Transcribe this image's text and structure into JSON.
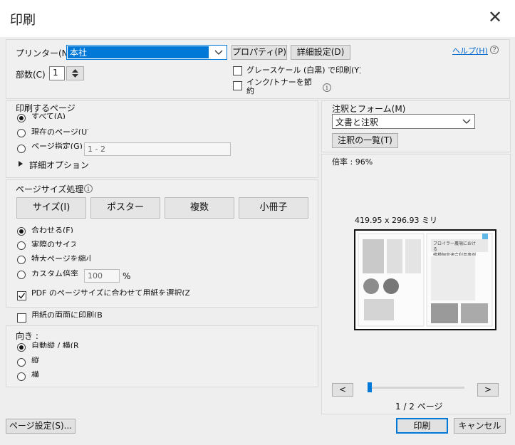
{
  "title": "印刷",
  "printer": {
    "label": "プリンター(N) :",
    "value": "本社",
    "properties_btn": "プロパティ(P)",
    "advanced_btn": "詳細設定(D)",
    "help_link": "ヘルプ(H)"
  },
  "copies": {
    "label": "部数(C) :",
    "value": "1"
  },
  "options": {
    "grayscale": "グレースケール (白黒) で印刷(Y)",
    "ink_save": "インク/トナーを節約"
  },
  "pages": {
    "header": "印刷するページ",
    "all": "すべて(A)",
    "current": "現在のページ(U)",
    "range": "ページ指定(G)",
    "range_placeholder": "1 - 2",
    "more": "詳細オプション"
  },
  "sizing": {
    "header": "ページサイズ処理",
    "buttons": [
      "サイズ(I)",
      "ポスター",
      "複数",
      "小冊子"
    ],
    "fit": "合わせる(F)",
    "actual": "実際のサイズ",
    "shrink": "特大ページを縮小",
    "custom": "カスタム倍率",
    "custom_value": "100",
    "percent": "%",
    "choose_paper": "PDF のページサイズに合わせて用紙を選択(Z)",
    "duplex": "用紙の両面に印刷(B)"
  },
  "orientation": {
    "header": "向き :",
    "auto": "自動縦 / 横(R)",
    "portrait": "縦",
    "landscape": "横"
  },
  "comments": {
    "header": "注釈とフォーム(M)",
    "value": "文書と注釈",
    "summary_btn": "注釈の一覧(T)"
  },
  "preview": {
    "scale": "倍率 : 96%",
    "size": "419.95 x 296.93 ミリ",
    "page_indicator": "1 / 2 ページ",
    "thumb_heading": "ブロイラー農場における\n雑種飼育適合利用事例",
    "prev": "<",
    "next": ">"
  },
  "footer": {
    "page_setup": "ページ設定(S)...",
    "print": "印刷",
    "cancel": "キャンセル"
  },
  "colors": {
    "accent": "#0078d7",
    "link": "#0066cc",
    "selection": "#0078d7"
  }
}
